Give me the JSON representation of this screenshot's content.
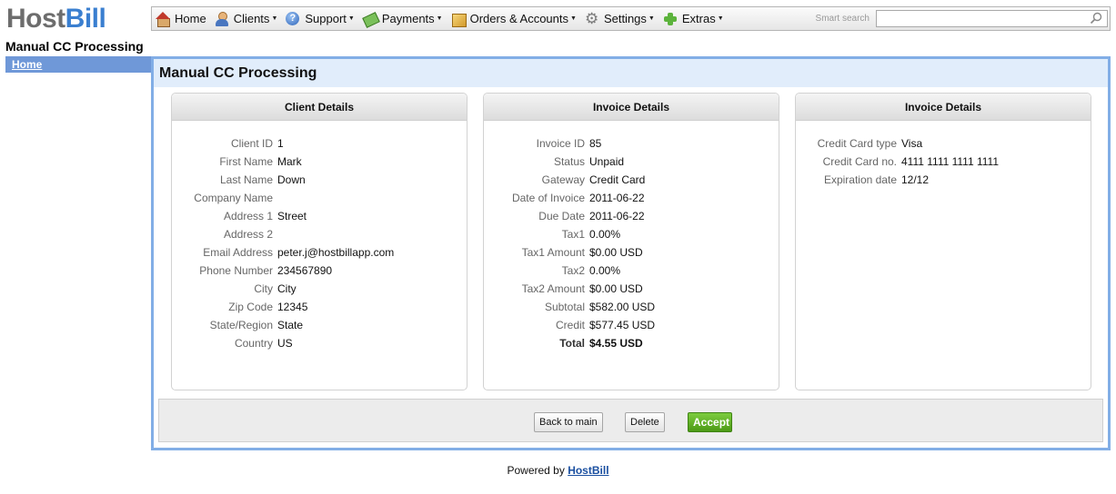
{
  "logo": {
    "part1": "Host",
    "part2": "Bill"
  },
  "page_heading": "Manual CC Processing",
  "nav": {
    "items": [
      {
        "label": "Home",
        "icon": "home-icon",
        "dropdown": false
      },
      {
        "label": "Clients",
        "icon": "clients-icon",
        "dropdown": true
      },
      {
        "label": "Support",
        "icon": "support-icon",
        "dropdown": true
      },
      {
        "label": "Payments",
        "icon": "payments-icon",
        "dropdown": true
      },
      {
        "label": "Orders & Accounts",
        "icon": "orders-icon",
        "dropdown": true
      },
      {
        "label": "Settings",
        "icon": "settings-icon",
        "dropdown": true
      },
      {
        "label": "Extras",
        "icon": "extras-icon",
        "dropdown": true
      }
    ],
    "smart_search_label": "Smart search",
    "smart_search_value": ""
  },
  "sidebar": {
    "home_label": "Home"
  },
  "main": {
    "title": "Manual CC Processing",
    "client": {
      "heading": "Client Details",
      "rows": [
        {
          "label": "Client ID",
          "value": "1"
        },
        {
          "label": "First Name",
          "value": "Mark"
        },
        {
          "label": "Last Name",
          "value": "Down"
        },
        {
          "label": "Company Name",
          "value": ""
        },
        {
          "label": "Address 1",
          "value": "Street"
        },
        {
          "label": "Address 2",
          "value": ""
        },
        {
          "label": "Email Address",
          "value": "peter.j@hostbillapp.com"
        },
        {
          "label": "Phone Number",
          "value": "234567890"
        },
        {
          "label": "City",
          "value": "City"
        },
        {
          "label": "Zip Code",
          "value": "12345"
        },
        {
          "label": "State/Region",
          "value": "State"
        },
        {
          "label": "Country",
          "value": "US"
        }
      ]
    },
    "invoice": {
      "heading": "Invoice Details",
      "rows": [
        {
          "label": "Invoice ID",
          "value": "85"
        },
        {
          "label": "Status",
          "value": "Unpaid"
        },
        {
          "label": "Gateway",
          "value": "Credit Card"
        },
        {
          "label": "Date of Invoice",
          "value": "2011-06-22"
        },
        {
          "label": "Due Date",
          "value": "2011-06-22"
        },
        {
          "label": "Tax1",
          "value": "0.00%"
        },
        {
          "label": "Tax1 Amount",
          "value": "$0.00 USD"
        },
        {
          "label": "Tax2",
          "value": "0.00%"
        },
        {
          "label": "Tax2 Amount",
          "value": "$0.00 USD"
        },
        {
          "label": "Subtotal",
          "value": "$582.00 USD"
        },
        {
          "label": "Credit",
          "value": "$577.45 USD"
        },
        {
          "label": "Total",
          "value": "$4.55 USD"
        }
      ]
    },
    "cc": {
      "heading": "Invoice Details",
      "rows": [
        {
          "label": "Credit Card type",
          "value": "Visa"
        },
        {
          "label": "Credit Card no.",
          "value": "4111 1111 1111 1111"
        },
        {
          "label": "Expiration date",
          "value": "12/12"
        }
      ]
    },
    "buttons": {
      "back": "Back to main",
      "delete": "Delete",
      "accept": "Accept"
    }
  },
  "footer": {
    "text": "Powered by",
    "link": "HostBill"
  },
  "colors": {
    "accent": "#82aee6",
    "sidebar_active": "#6f98d8",
    "accept": "#5aa81f",
    "title_bar": "#e1edfb"
  }
}
